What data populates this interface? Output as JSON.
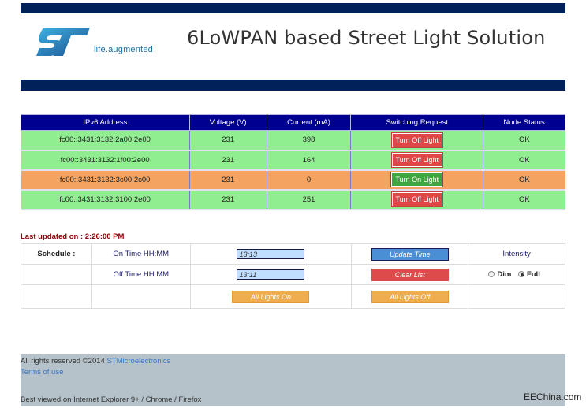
{
  "header": {
    "logo_tagline": "life.augmented",
    "title": "6LoWPAN based Street Light Solution"
  },
  "nodes_table": {
    "columns": [
      "IPv6 Address",
      "Voltage (V)",
      "Current (mA)",
      "Switching Request",
      "Node Status"
    ],
    "rows": [
      {
        "address": "fc00::3431:3132:2a00:2e00",
        "voltage": "231",
        "current": "398",
        "switch_label": "Turn Off Light",
        "status": "OK"
      },
      {
        "address": "fc00::3431:3132:1f00:2e00",
        "voltage": "231",
        "current": "164",
        "switch_label": "Turn Off Light",
        "status": "OK"
      },
      {
        "address": "fc00::3431:3132:3c00:2c00",
        "voltage": "231",
        "current": "0",
        "switch_label": "Turn On Light",
        "status": "OK"
      },
      {
        "address": "fc00::3431:3132:3100:2e00",
        "voltage": "231",
        "current": "251",
        "switch_label": "Turn Off Light",
        "status": "OK"
      }
    ]
  },
  "last_updated": "Last updated on : 2:26:00 PM",
  "schedule": {
    "label": "Schedule :",
    "on_time_label": "On Time HH:MM",
    "on_time_value": "13:13",
    "off_time_label": "Off Time HH:MM",
    "off_time_value": "13:11",
    "update_time_button": "Update Time",
    "clear_list_button": "Clear List",
    "all_on_button": "All Lights On",
    "all_off_button": "All Lights Off",
    "intensity_label": "Intensity",
    "intensity_options": [
      "Dim",
      "Full"
    ],
    "intensity_selected": "Full"
  },
  "footer": {
    "rights_prefix": "All rights reserved ©2014 ",
    "company_link": "STMicroelectronics",
    "terms_link": "Terms of use",
    "best_viewed": "Best viewed on Internet Explorer 9+ / Chrome / Firefox"
  },
  "watermark": "EEChina.com",
  "colors": {
    "navy": "#00215a",
    "table_header": "#000090",
    "row_ok": "#90ee90",
    "row_off": "#f4a460",
    "btn_red": "#e04646",
    "btn_green": "#3fa63f",
    "btn_blue": "#4a8fd4",
    "btn_orange": "#f0ad4e",
    "footer_bg": "#b5c2c9"
  }
}
